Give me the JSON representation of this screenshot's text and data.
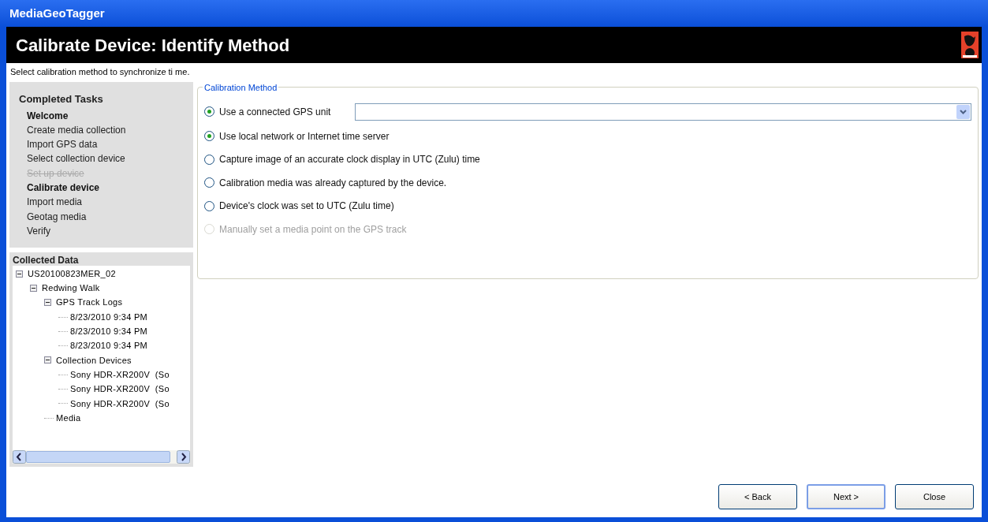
{
  "window": {
    "title": "MediaGeoTagger"
  },
  "header": {
    "title": "Calibrate Device: Identify Method"
  },
  "instruction": "Select calibration method to synchronize ti me.",
  "completed_tasks": {
    "title": "Completed Tasks",
    "items": [
      {
        "label": "Welcome",
        "kind": "current"
      },
      {
        "label": "Create media collection",
        "kind": "plain"
      },
      {
        "label": "Import GPS data",
        "kind": "plain"
      },
      {
        "label": "Select collection device",
        "kind": "plain"
      },
      {
        "label": "Set up device",
        "kind": "skipped"
      },
      {
        "label": "Calibrate device",
        "kind": "current"
      },
      {
        "label": "Import media",
        "kind": "plain"
      },
      {
        "label": "Geotag media",
        "kind": "plain"
      },
      {
        "label": "Verify",
        "kind": "plain"
      }
    ]
  },
  "collected_data": {
    "title": "Collected Data",
    "tree": [
      {
        "label": "US20100823MER_02",
        "expanded": true,
        "children": [
          {
            "label": "Redwing Walk",
            "expanded": true,
            "children": [
              {
                "label": "GPS Track Logs",
                "expanded": true,
                "children": [
                  {
                    "label": "8/23/2010 9:34 PM"
                  },
                  {
                    "label": "8/23/2010 9:34 PM"
                  },
                  {
                    "label": "8/23/2010 9:34 PM"
                  }
                ]
              },
              {
                "label": "Collection Devices",
                "expanded": true,
                "children": [
                  {
                    "label": "Sony HDR-XR200V  (So"
                  },
                  {
                    "label": "Sony HDR-XR200V  (So"
                  },
                  {
                    "label": "Sony HDR-XR200V  (So"
                  }
                ]
              },
              {
                "label": "Media"
              }
            ]
          }
        ]
      }
    ]
  },
  "calibration_method": {
    "title": "Calibration Method",
    "options": [
      {
        "label": "Use a connected GPS unit",
        "selected": true,
        "disabled": false,
        "kind": "dropdown"
      },
      {
        "label": "Use local network or Internet time server",
        "selected": true,
        "disabled": false,
        "kind": "plain"
      },
      {
        "label": "Capture image of an accurate clock display in UTC (Zulu) time",
        "selected": false,
        "disabled": false,
        "kind": "plain"
      },
      {
        "label": "Calibration media was already captured by the device.",
        "selected": false,
        "disabled": false,
        "kind": "plain"
      },
      {
        "label": "Device's clock was set to UTC (Zulu time)",
        "selected": false,
        "disabled": false,
        "kind": "plain"
      },
      {
        "label": "Manually set a media point on the GPS track",
        "selected": false,
        "disabled": true,
        "kind": "plain"
      }
    ]
  },
  "buttons": [
    {
      "label": "< Back",
      "default": false
    },
    {
      "label": "Next >",
      "default": true
    },
    {
      "label": "Close",
      "default": false
    }
  ]
}
